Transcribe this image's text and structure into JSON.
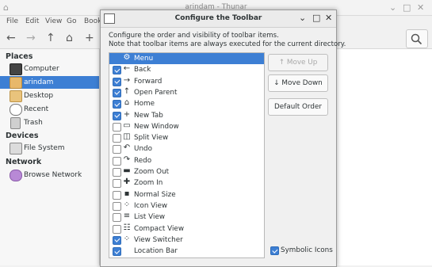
{
  "thunar": {
    "title": "arindam - Thunar",
    "menu": [
      "File",
      "Edit",
      "View",
      "Go",
      "Book"
    ],
    "sidebar": {
      "places_heading": "Places",
      "places": [
        {
          "label": "Computer",
          "icon": "computer-icon",
          "selected": false
        },
        {
          "label": "arindam",
          "icon": "home-folder-icon",
          "selected": true
        },
        {
          "label": "Desktop",
          "icon": "desktop-folder-icon",
          "selected": false
        },
        {
          "label": "Recent",
          "icon": "recent-icon",
          "selected": false
        },
        {
          "label": "Trash",
          "icon": "trash-icon",
          "selected": false
        }
      ],
      "devices_heading": "Devices",
      "devices": [
        {
          "label": "File System",
          "icon": "drive-icon"
        }
      ],
      "network_heading": "Network",
      "network": [
        {
          "label": "Browse Network",
          "icon": "network-icon"
        }
      ]
    }
  },
  "dialog": {
    "title": "Configure the Toolbar",
    "description_line1": "Configure the order and visibility of toolbar items.",
    "description_line2": "Note that toolbar items are always executed for the current directory.",
    "items": [
      {
        "label": "Menu",
        "glyph": "⚙",
        "checked": true,
        "selected": true,
        "show_checkbox": false
      },
      {
        "label": "Back",
        "glyph": "←",
        "checked": true
      },
      {
        "label": "Forward",
        "glyph": "→",
        "checked": true
      },
      {
        "label": "Open Parent",
        "glyph": "↑",
        "checked": true
      },
      {
        "label": "Home",
        "glyph": "⌂",
        "checked": true
      },
      {
        "label": "New Tab",
        "glyph": "+",
        "checked": true
      },
      {
        "label": "New Window",
        "glyph": "▭",
        "checked": false
      },
      {
        "label": "Split View",
        "glyph": "◫",
        "checked": false
      },
      {
        "label": "Undo",
        "glyph": "↶",
        "checked": false
      },
      {
        "label": "Redo",
        "glyph": "↷",
        "checked": false
      },
      {
        "label": "Zoom Out",
        "glyph": "▬",
        "checked": false
      },
      {
        "label": "Zoom In",
        "glyph": "✚",
        "checked": false
      },
      {
        "label": "Normal Size",
        "glyph": "▪",
        "checked": false
      },
      {
        "label": "Icon View",
        "glyph": "⁘",
        "checked": false
      },
      {
        "label": "List View",
        "glyph": "≡",
        "checked": false
      },
      {
        "label": "Compact View",
        "glyph": "☷",
        "checked": false
      },
      {
        "label": "View Switcher",
        "glyph": "⁘",
        "checked": true
      },
      {
        "label": "Location Bar",
        "glyph": "",
        "checked": true
      }
    ],
    "buttons": {
      "move_up": "Move Up",
      "move_down": "Move Down",
      "default_order": "Default Order"
    },
    "symbolic_icons_label": "Symbolic Icons",
    "symbolic_icons_checked": true
  },
  "colors": {
    "accent": "#3d7fd4"
  }
}
